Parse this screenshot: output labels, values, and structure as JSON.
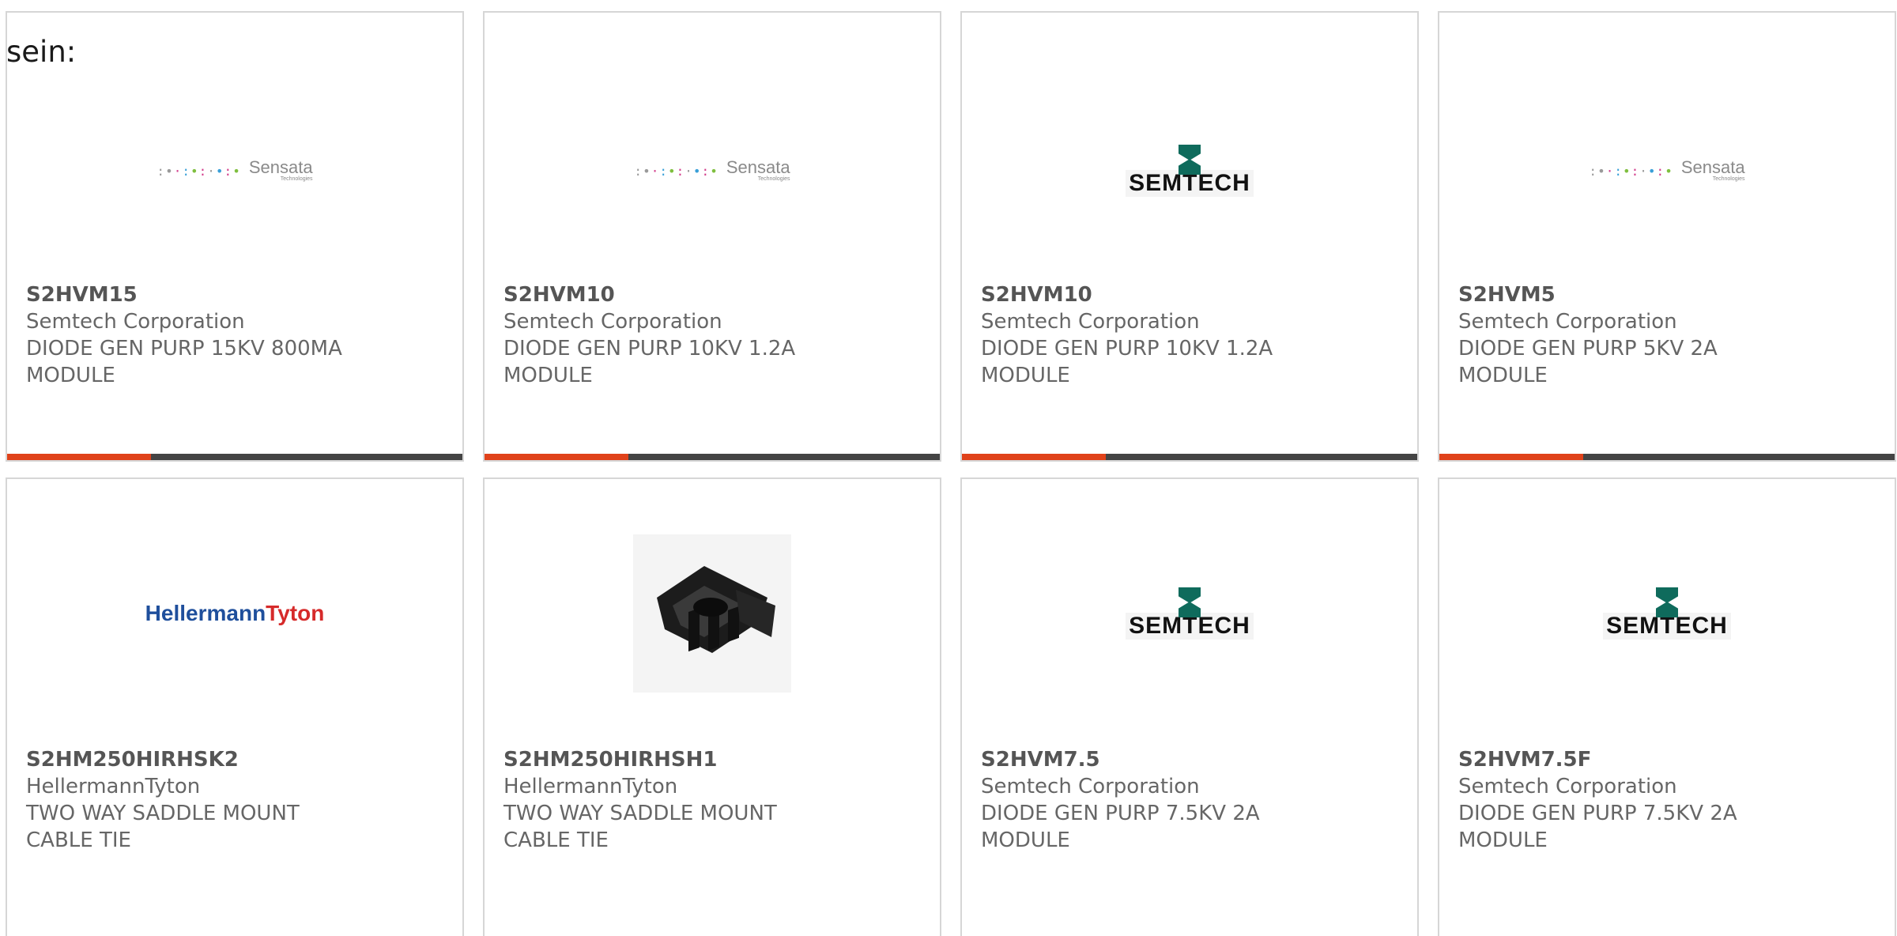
{
  "intro_text": "sein:",
  "colors": {
    "accent_bar": "#e0421a",
    "bar_track": "#444444",
    "border": "#d6d6d6",
    "semtech_green": "#0f6b5c",
    "hellermann_blue": "#1f4f9c",
    "hellermann_red": "#d62a2a"
  },
  "logos": {
    "sensata_name": "Sensata",
    "sensata_sub": "Technologies",
    "semtech_word": "SEMTECH",
    "hellermann_blue": "Hellermann",
    "hellermann_red": "Tyton"
  },
  "cards": [
    {
      "part_number": "S2HVM15",
      "manufacturer": "Semtech Corporation",
      "desc_line1": "DIODE GEN PURP 15KV 800MA",
      "desc_line2": "MODULE",
      "logo": "sensata-logo"
    },
    {
      "part_number": "S2HVM10",
      "manufacturer": "Semtech Corporation",
      "desc_line1": "DIODE GEN PURP 10KV 1.2A",
      "desc_line2": "MODULE",
      "logo": "sensata-logo"
    },
    {
      "part_number": "S2HVM10",
      "manufacturer": "Semtech Corporation",
      "desc_line1": "DIODE GEN PURP 10KV 1.2A",
      "desc_line2": "MODULE",
      "logo": "semtech-logo"
    },
    {
      "part_number": "S2HVM5",
      "manufacturer": "Semtech Corporation",
      "desc_line1": "DIODE GEN PURP 5KV 2A",
      "desc_line2": "MODULE",
      "logo": "sensata-logo"
    },
    {
      "part_number": "S2HM250HIRHSK2",
      "manufacturer": "HellermannTyton",
      "desc_line1": "TWO WAY SADDLE MOUNT",
      "desc_line2": "CABLE TIE",
      "logo": "hellermanntyton-logo"
    },
    {
      "part_number": "S2HM250HIRHSH1",
      "manufacturer": "HellermannTyton",
      "desc_line1": "TWO WAY SADDLE MOUNT",
      "desc_line2": "CABLE TIE",
      "logo": "cable-tie-mount-image"
    },
    {
      "part_number": "S2HVM7.5",
      "manufacturer": "Semtech Corporation",
      "desc_line1": "DIODE GEN PURP 7.5KV 2A",
      "desc_line2": "MODULE",
      "logo": "semtech-logo"
    },
    {
      "part_number": "S2HVM7.5F",
      "manufacturer": "Semtech Corporation",
      "desc_line1": "DIODE GEN PURP 7.5KV 2A",
      "desc_line2": "MODULE",
      "logo": "semtech-logo"
    }
  ]
}
